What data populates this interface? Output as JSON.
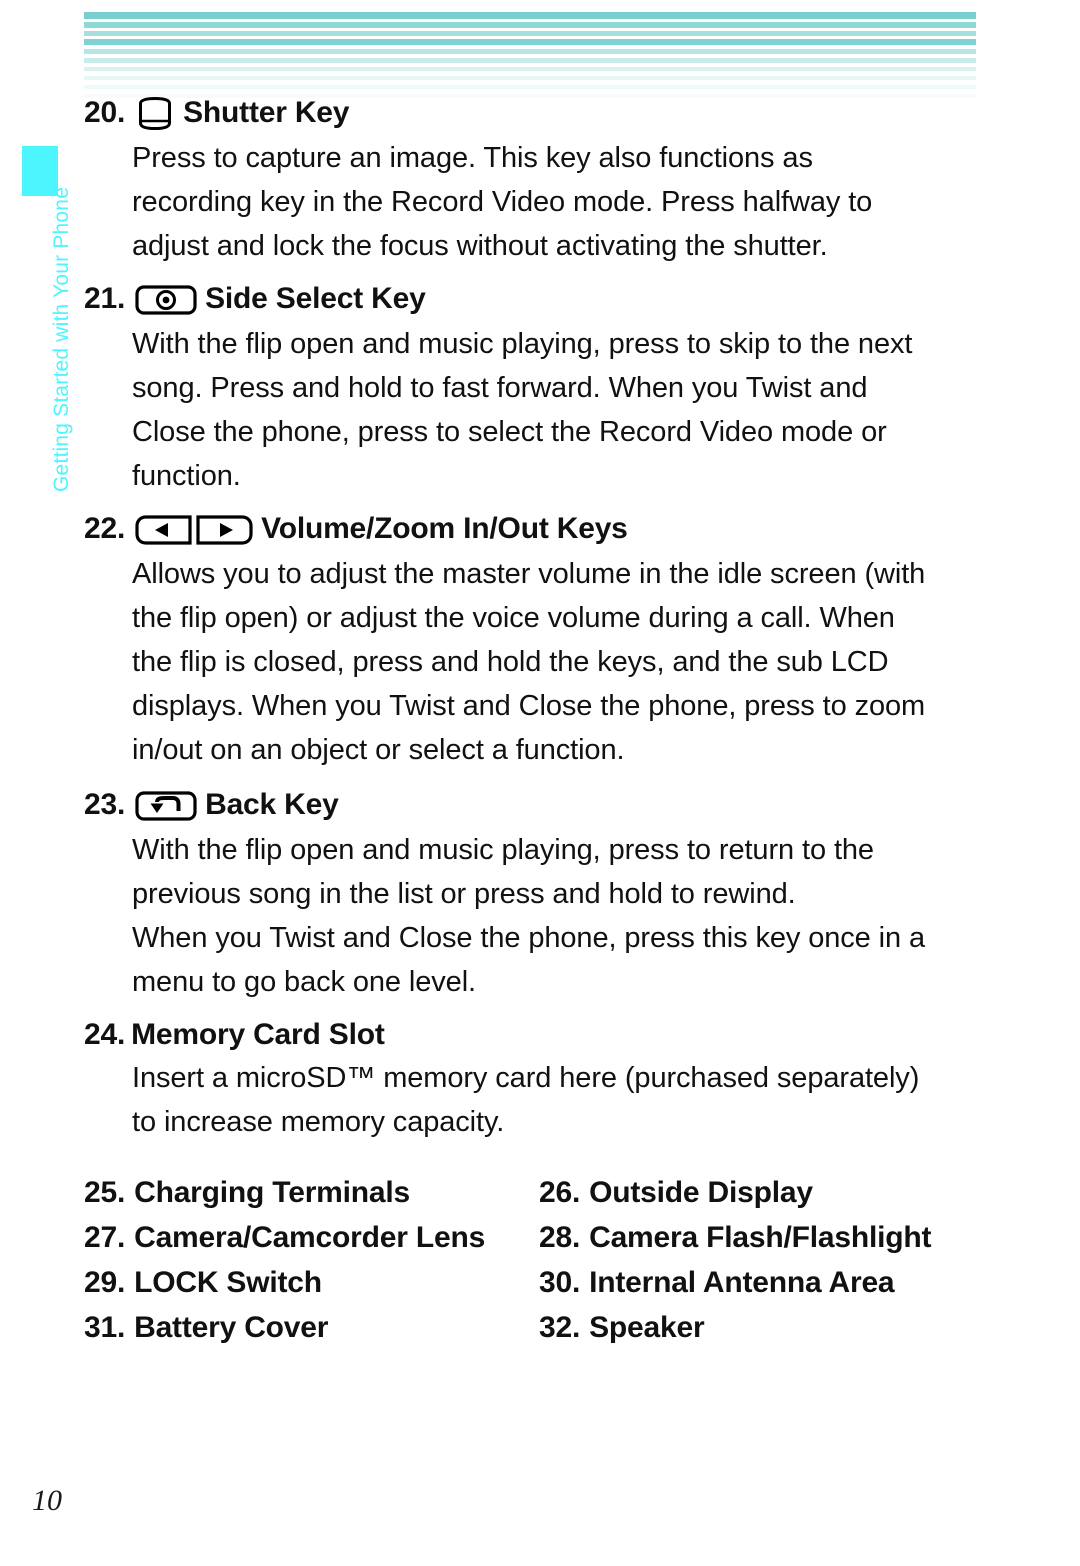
{
  "sidebar": {
    "chapter_label": "Getting Started with Your Phone",
    "tab_color": "#4DF6FF",
    "label_color": "#4DF6FF"
  },
  "header": {
    "stripe_colors": [
      "#79cfcf",
      "#8ed8d6",
      "#a5dedd",
      "#7fd2d1",
      "#b5e5e4",
      "#c8ecec",
      "#d8f2f2",
      "#e6f7f7",
      "#eefafa",
      "#f6fcfc"
    ]
  },
  "entries": [
    {
      "num": "20.",
      "icon": "shutter-key-icon",
      "title": "Shutter Key",
      "body": [
        "Press to capture an image. This key also functions as",
        "recording key in the Record Video mode. Press halfway to",
        "adjust and lock the focus without activating the shutter."
      ]
    },
    {
      "num": "21.",
      "icon": "side-select-key-icon",
      "title": "Side Select Key",
      "body": [
        "With the flip open and music playing, press to skip to the next",
        "song. Press and hold to fast forward. When you Twist and",
        "Close the phone, press to select the Record Video mode or",
        "function."
      ]
    },
    {
      "num": "22.",
      "icon": "volume-zoom-keys-icon",
      "title": "Volume/Zoom In/Out Keys",
      "body": [
        "Allows you to adjust the master volume in the idle screen (with",
        "the flip open) or adjust the voice volume during a call. When",
        "the flip is closed, press and hold the keys, and the sub LCD",
        "displays. When you Twist and Close the phone, press to zoom",
        "in/out on an object or select a function."
      ]
    },
    {
      "num": "23.",
      "icon": "back-key-icon",
      "title": "Back Key",
      "body": [
        "With the flip open and music playing, press to return to the",
        "previous song in the list or press and hold to rewind.",
        "When you Twist and Close the phone, press this key once in a",
        "menu to go back one level."
      ]
    },
    {
      "num": "24.",
      "icon": null,
      "title": "Memory Card Slot",
      "body": [
        "Insert a microSD™ memory card here (purchased separately)",
        "to increase memory capacity."
      ]
    }
  ],
  "pair_list": [
    {
      "left_num": "25.",
      "left_label": "Charging Terminals",
      "right_num": "26.",
      "right_label": "Outside Display"
    },
    {
      "left_num": "27.",
      "left_label": "Camera/Camcorder Lens",
      "right_num": "28.",
      "right_label": "Camera Flash/Flashlight"
    },
    {
      "left_num": "29.",
      "left_label": "LOCK Switch",
      "right_num": "30.",
      "right_label": "Internal Antenna Area"
    },
    {
      "left_num": "31.",
      "left_label": "Battery Cover",
      "right_num": "32.",
      "right_label": "Speaker"
    }
  ],
  "footer": {
    "page_number": "10"
  }
}
